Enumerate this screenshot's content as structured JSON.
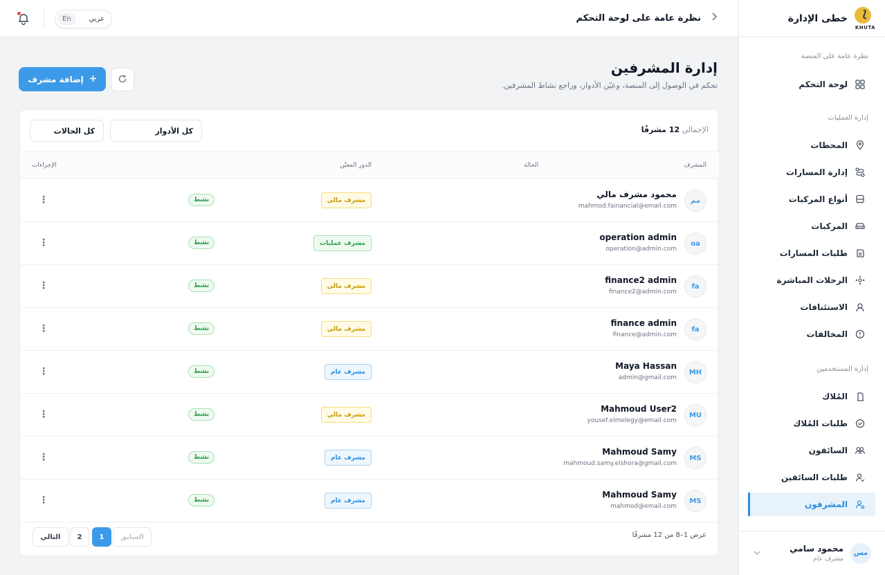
{
  "header": {
    "brand_name": "خطى الإدارة",
    "logo_text": "KHUTA",
    "breadcrumb": "نظرة عامة على لوحة التحكم",
    "lang_ar": "عربي",
    "lang_en": "En"
  },
  "sidebar": {
    "sections": [
      {
        "title": "نظرة عامة على المنصة",
        "items": [
          {
            "label": "لوحة التحكم",
            "icon": "grid-icon"
          }
        ]
      },
      {
        "title": "إدارة العمليات",
        "items": [
          {
            "label": "المحطات",
            "icon": "map-pin-icon"
          },
          {
            "label": "إدارة المسارات",
            "icon": "route-icon"
          },
          {
            "label": "أنواع المركبات",
            "icon": "bus-icon"
          },
          {
            "label": "المركبات",
            "icon": "car-icon"
          },
          {
            "label": "طلبات المسارات",
            "icon": "route-request-icon"
          },
          {
            "label": "الرحلات المباشرة",
            "icon": "live-trips-icon"
          },
          {
            "label": "الاستئنافات",
            "icon": "appeals-icon"
          },
          {
            "label": "المخالفات",
            "icon": "alert-circle-icon"
          }
        ]
      },
      {
        "title": "إدارة المستخدمين",
        "items": [
          {
            "label": "المُلاك",
            "icon": "owner-icon"
          },
          {
            "label": "طلبات المُلاك",
            "icon": "check-circle-icon"
          },
          {
            "label": "السائقون",
            "icon": "users-icon"
          },
          {
            "label": "طلبات السائقين",
            "icon": "user-check-icon"
          },
          {
            "label": "المشرفون",
            "icon": "user-gear-icon",
            "active": true
          }
        ]
      }
    ],
    "profile": {
      "initials": "مس",
      "name": "محمود سامي",
      "role": "مشرف عام"
    }
  },
  "page": {
    "title": "إدارة المشرفين",
    "subtitle": "تحكم في الوصول إلى المنصة، وعيّن الأدوار، وراجع نشاط المشرفين.",
    "add_button": "إضافة مشرف"
  },
  "filters": {
    "total_label": "الإجمالي",
    "total_value": "12 مشرفًا",
    "roles_select": "كل الأدوار",
    "status_select": "كل الحالات"
  },
  "table": {
    "columns": {
      "supervisor": "المشرف",
      "role": "الدور المعيّن",
      "status": "الحالة",
      "actions": "الإجراءات"
    },
    "rows": [
      {
        "initials": "مم",
        "name": "محمود مشرف مالي",
        "email": "mahmod.fainancial@email.com",
        "role": "مشرف مالي",
        "role_type": "fin",
        "status": "نشط"
      },
      {
        "initials": "oa",
        "name": "operation admin",
        "email": "operation@admin.com",
        "role": "مشرف عمليات",
        "role_type": "ops",
        "status": "نشط"
      },
      {
        "initials": "fa",
        "name": "finance2 admin",
        "email": "finance2@admin.com",
        "role": "مشرف مالي",
        "role_type": "fin",
        "status": "نشط"
      },
      {
        "initials": "fa",
        "name": "finance admin",
        "email": "finance@admin.com",
        "role": "مشرف مالي",
        "role_type": "fin",
        "status": "نشط"
      },
      {
        "initials": "MH",
        "name": "Maya Hassan",
        "email": "admin@gmail.com",
        "role": "مشرف عام",
        "role_type": "gen",
        "status": "نشط"
      },
      {
        "initials": "MU",
        "name": "Mahmoud User2",
        "email": "yousef.elmelegy@email.com",
        "role": "مشرف مالي",
        "role_type": "fin",
        "status": "نشط"
      },
      {
        "initials": "MS",
        "name": "Mahmoud Samy",
        "email": "mahmoud.samy.elshora@gmail.com",
        "role": "مشرف عام",
        "role_type": "gen",
        "status": "نشط"
      },
      {
        "initials": "MS",
        "name": "Mahmoud Samy",
        "email": "mahmod@email.com",
        "role": "مشرف عام",
        "role_type": "gen",
        "status": "نشط"
      }
    ]
  },
  "pagination": {
    "showing": "عرض 1–8 من 12 مشرفًا",
    "prev": "السابق",
    "pages": [
      "1",
      "2"
    ],
    "current": "1",
    "next": "التالي"
  },
  "colors": {
    "accent": "#3d9ae8",
    "active_green": "#2f9e4d",
    "financial_yellow": "#c99a08"
  }
}
